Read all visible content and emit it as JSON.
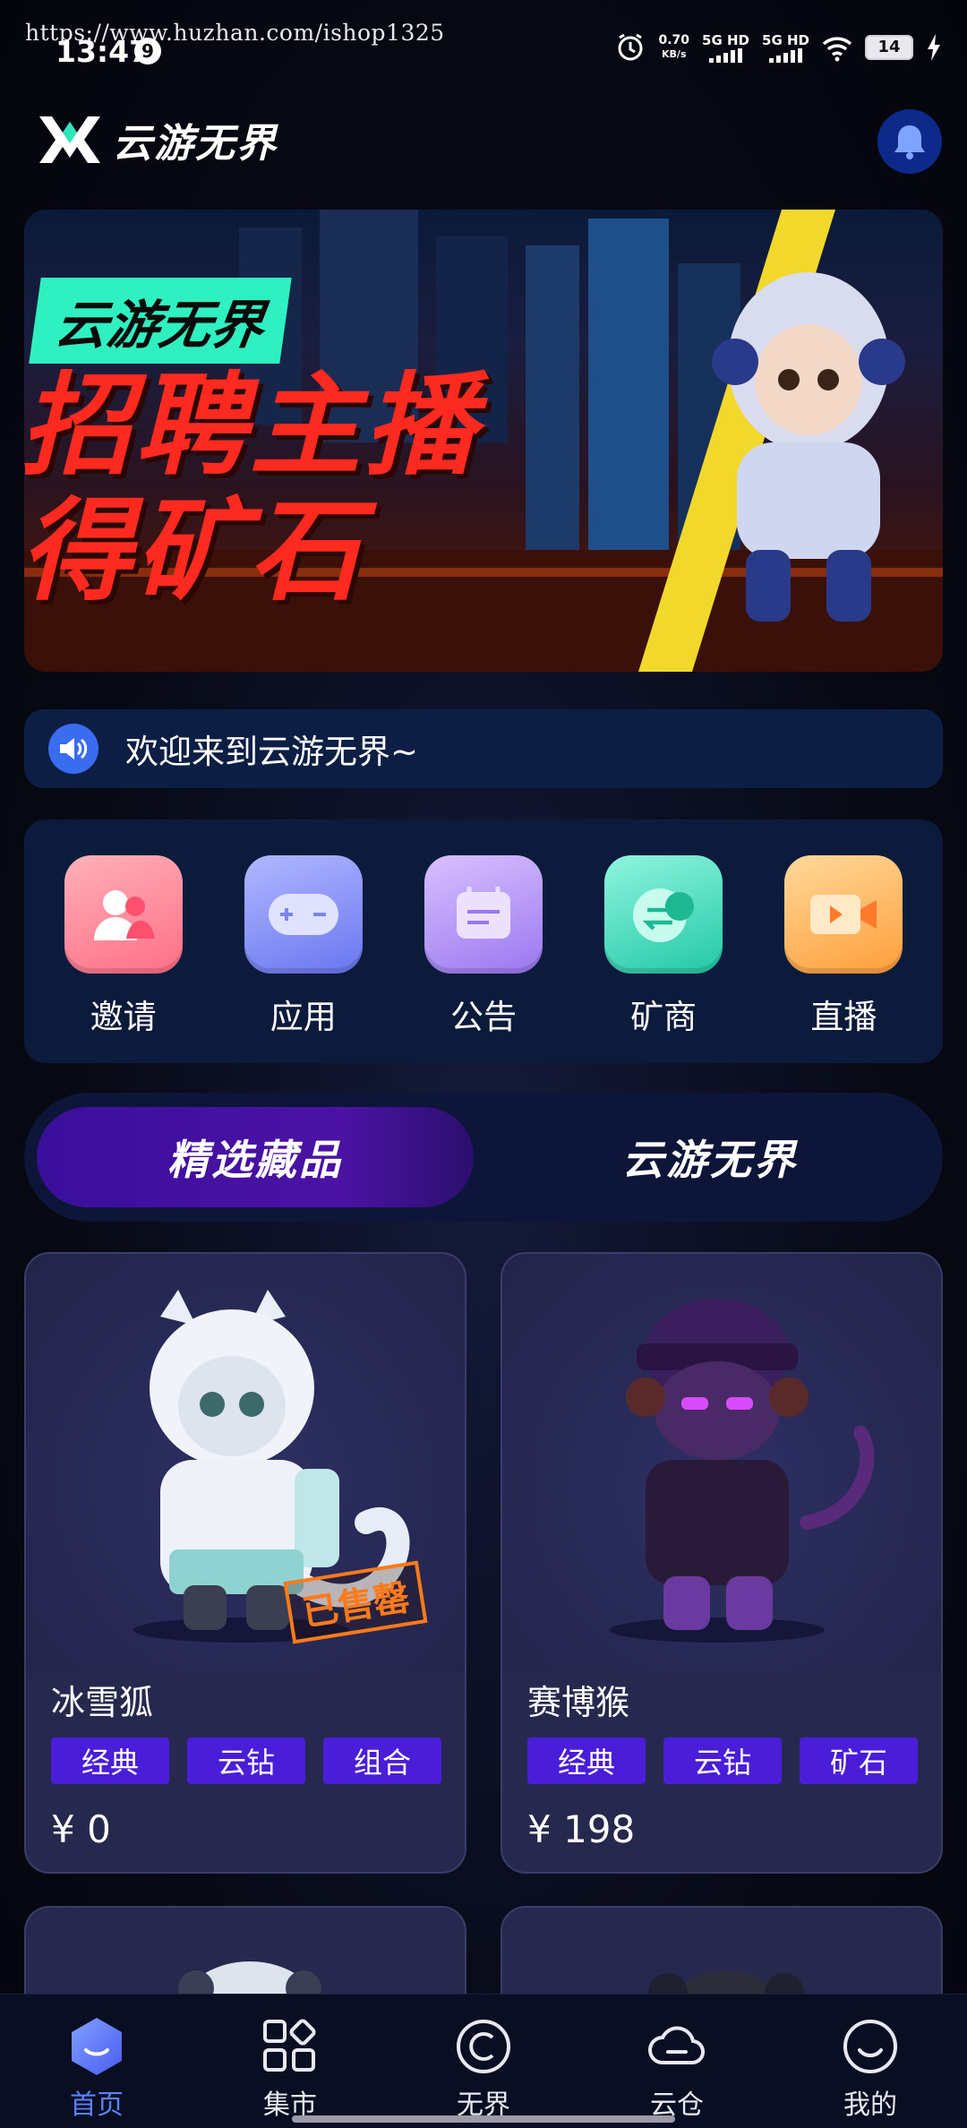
{
  "status_bar": {
    "watermark": "https://www.huzhan.com/ishop1325",
    "time": "13:47",
    "notification_count": "9",
    "net_speed_value": "0.70",
    "net_speed_unit": "KB/s",
    "sim1": "5G HD",
    "sim2": "5G HD",
    "battery": "14"
  },
  "header": {
    "app_name": "云游无界"
  },
  "banner": {
    "tag": "云游无界",
    "headline_1": "招聘主播",
    "headline_2": "得矿石"
  },
  "notice": {
    "text": "欢迎来到云游无界~"
  },
  "quick_menu": [
    {
      "label": "邀请",
      "icon": "invite-icon",
      "color_from": "#ff9aa6",
      "color_to": "#ff6f86"
    },
    {
      "label": "应用",
      "icon": "gamepad-icon",
      "color_from": "#9aa6ff",
      "color_to": "#6a76f0"
    },
    {
      "label": "公告",
      "icon": "announcement-icon",
      "color_from": "#c7a8ff",
      "color_to": "#9a78f0"
    },
    {
      "label": "矿商",
      "icon": "exchange-icon",
      "color_from": "#6ff0d2",
      "color_to": "#22c8a6"
    },
    {
      "label": "直播",
      "icon": "live-video-icon",
      "color_from": "#ffcc7a",
      "color_to": "#ff9e3a"
    }
  ],
  "tabs": {
    "active": "精选藏品",
    "other": "云游无界"
  },
  "products": [
    {
      "name": "冰雪狐",
      "tags": [
        "经典",
        "云钻",
        "组合"
      ],
      "price": "¥ 0",
      "sold_out": "已售罄"
    },
    {
      "name": "赛博猴",
      "tags": [
        "经典",
        "云钻",
        "矿石"
      ],
      "price": "¥ 198"
    }
  ],
  "bottom_nav": [
    {
      "label": "首页",
      "icon": "home-icon",
      "active": true
    },
    {
      "label": "集市",
      "icon": "market-icon",
      "active": false
    },
    {
      "label": "无界",
      "icon": "infinity-icon",
      "active": false
    },
    {
      "label": "云仓",
      "icon": "cloud-icon",
      "active": false
    },
    {
      "label": "我的",
      "icon": "profile-icon",
      "active": false
    }
  ],
  "colors": {
    "accent": "#5b82ff",
    "tag_bg": "#4a1ed8",
    "sold_out": "#ff7a1a",
    "banner_headline": "#ff2a1f",
    "banner_tag": "#2ff0c0"
  }
}
